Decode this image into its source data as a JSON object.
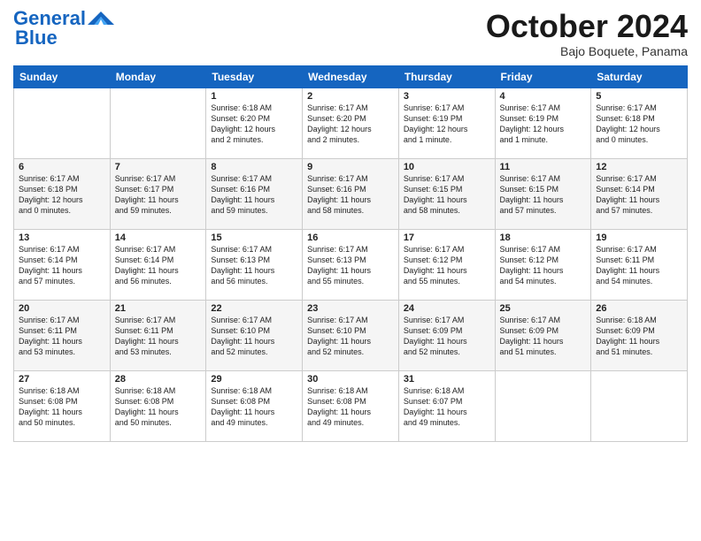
{
  "header": {
    "logo_line1": "General",
    "logo_line2": "Blue",
    "month": "October 2024",
    "location": "Bajo Boquete, Panama"
  },
  "weekdays": [
    "Sunday",
    "Monday",
    "Tuesday",
    "Wednesday",
    "Thursday",
    "Friday",
    "Saturday"
  ],
  "weeks": [
    [
      {
        "day": "",
        "text": ""
      },
      {
        "day": "",
        "text": ""
      },
      {
        "day": "1",
        "text": "Sunrise: 6:18 AM\nSunset: 6:20 PM\nDaylight: 12 hours\nand 2 minutes."
      },
      {
        "day": "2",
        "text": "Sunrise: 6:17 AM\nSunset: 6:20 PM\nDaylight: 12 hours\nand 2 minutes."
      },
      {
        "day": "3",
        "text": "Sunrise: 6:17 AM\nSunset: 6:19 PM\nDaylight: 12 hours\nand 1 minute."
      },
      {
        "day": "4",
        "text": "Sunrise: 6:17 AM\nSunset: 6:19 PM\nDaylight: 12 hours\nand 1 minute."
      },
      {
        "day": "5",
        "text": "Sunrise: 6:17 AM\nSunset: 6:18 PM\nDaylight: 12 hours\nand 0 minutes."
      }
    ],
    [
      {
        "day": "6",
        "text": "Sunrise: 6:17 AM\nSunset: 6:18 PM\nDaylight: 12 hours\nand 0 minutes."
      },
      {
        "day": "7",
        "text": "Sunrise: 6:17 AM\nSunset: 6:17 PM\nDaylight: 11 hours\nand 59 minutes."
      },
      {
        "day": "8",
        "text": "Sunrise: 6:17 AM\nSunset: 6:16 PM\nDaylight: 11 hours\nand 59 minutes."
      },
      {
        "day": "9",
        "text": "Sunrise: 6:17 AM\nSunset: 6:16 PM\nDaylight: 11 hours\nand 58 minutes."
      },
      {
        "day": "10",
        "text": "Sunrise: 6:17 AM\nSunset: 6:15 PM\nDaylight: 11 hours\nand 58 minutes."
      },
      {
        "day": "11",
        "text": "Sunrise: 6:17 AM\nSunset: 6:15 PM\nDaylight: 11 hours\nand 57 minutes."
      },
      {
        "day": "12",
        "text": "Sunrise: 6:17 AM\nSunset: 6:14 PM\nDaylight: 11 hours\nand 57 minutes."
      }
    ],
    [
      {
        "day": "13",
        "text": "Sunrise: 6:17 AM\nSunset: 6:14 PM\nDaylight: 11 hours\nand 57 minutes."
      },
      {
        "day": "14",
        "text": "Sunrise: 6:17 AM\nSunset: 6:14 PM\nDaylight: 11 hours\nand 56 minutes."
      },
      {
        "day": "15",
        "text": "Sunrise: 6:17 AM\nSunset: 6:13 PM\nDaylight: 11 hours\nand 56 minutes."
      },
      {
        "day": "16",
        "text": "Sunrise: 6:17 AM\nSunset: 6:13 PM\nDaylight: 11 hours\nand 55 minutes."
      },
      {
        "day": "17",
        "text": "Sunrise: 6:17 AM\nSunset: 6:12 PM\nDaylight: 11 hours\nand 55 minutes."
      },
      {
        "day": "18",
        "text": "Sunrise: 6:17 AM\nSunset: 6:12 PM\nDaylight: 11 hours\nand 54 minutes."
      },
      {
        "day": "19",
        "text": "Sunrise: 6:17 AM\nSunset: 6:11 PM\nDaylight: 11 hours\nand 54 minutes."
      }
    ],
    [
      {
        "day": "20",
        "text": "Sunrise: 6:17 AM\nSunset: 6:11 PM\nDaylight: 11 hours\nand 53 minutes."
      },
      {
        "day": "21",
        "text": "Sunrise: 6:17 AM\nSunset: 6:11 PM\nDaylight: 11 hours\nand 53 minutes."
      },
      {
        "day": "22",
        "text": "Sunrise: 6:17 AM\nSunset: 6:10 PM\nDaylight: 11 hours\nand 52 minutes."
      },
      {
        "day": "23",
        "text": "Sunrise: 6:17 AM\nSunset: 6:10 PM\nDaylight: 11 hours\nand 52 minutes."
      },
      {
        "day": "24",
        "text": "Sunrise: 6:17 AM\nSunset: 6:09 PM\nDaylight: 11 hours\nand 52 minutes."
      },
      {
        "day": "25",
        "text": "Sunrise: 6:17 AM\nSunset: 6:09 PM\nDaylight: 11 hours\nand 51 minutes."
      },
      {
        "day": "26",
        "text": "Sunrise: 6:18 AM\nSunset: 6:09 PM\nDaylight: 11 hours\nand 51 minutes."
      }
    ],
    [
      {
        "day": "27",
        "text": "Sunrise: 6:18 AM\nSunset: 6:08 PM\nDaylight: 11 hours\nand 50 minutes."
      },
      {
        "day": "28",
        "text": "Sunrise: 6:18 AM\nSunset: 6:08 PM\nDaylight: 11 hours\nand 50 minutes."
      },
      {
        "day": "29",
        "text": "Sunrise: 6:18 AM\nSunset: 6:08 PM\nDaylight: 11 hours\nand 49 minutes."
      },
      {
        "day": "30",
        "text": "Sunrise: 6:18 AM\nSunset: 6:08 PM\nDaylight: 11 hours\nand 49 minutes."
      },
      {
        "day": "31",
        "text": "Sunrise: 6:18 AM\nSunset: 6:07 PM\nDaylight: 11 hours\nand 49 minutes."
      },
      {
        "day": "",
        "text": ""
      },
      {
        "day": "",
        "text": ""
      }
    ]
  ]
}
